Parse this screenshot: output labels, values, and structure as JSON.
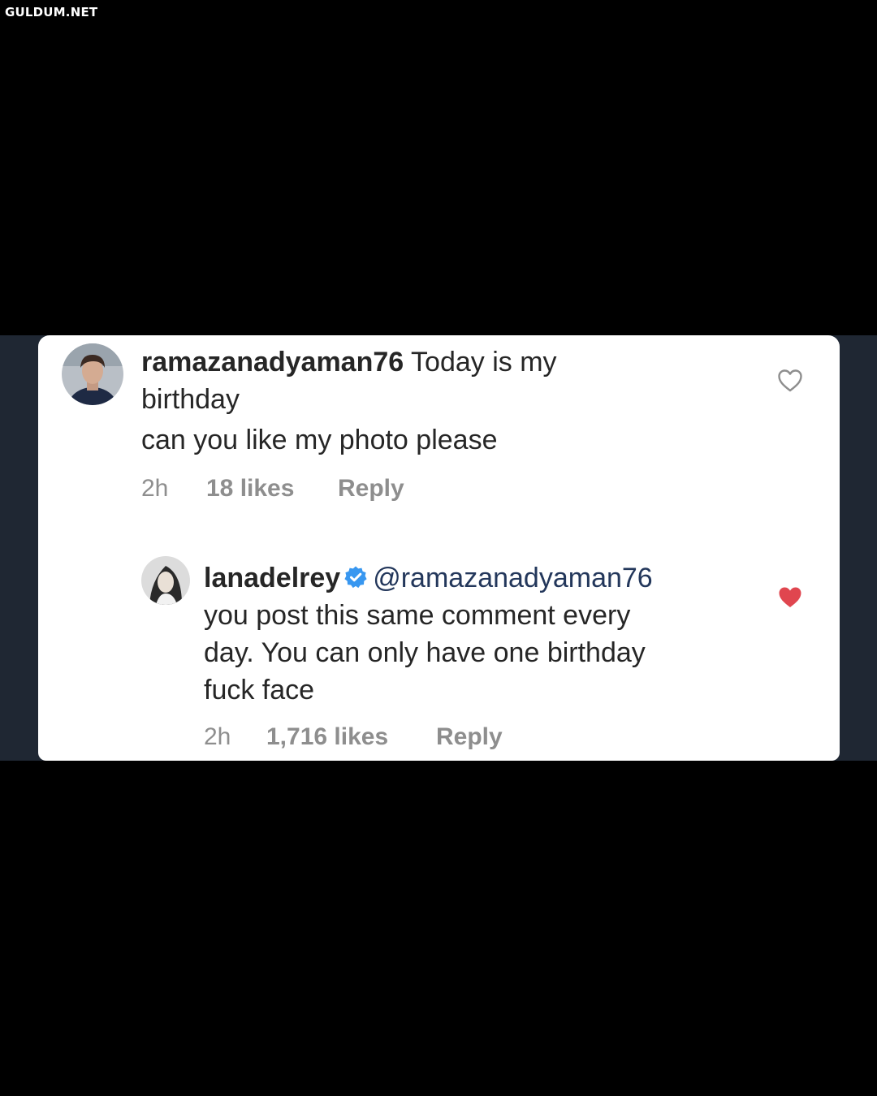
{
  "watermark": "GULDUM.NET",
  "colors": {
    "background": "#000000",
    "band": "#1f2733",
    "card": "#ffffff",
    "text": "#262626",
    "meta": "#8e8e8e",
    "mention": "#23375b",
    "verified": "#3897f0",
    "liked_heart": "#e0464f"
  },
  "comments": [
    {
      "username": "ramazanadyaman76",
      "text_lines": [
        "Today is my",
        "birthday",
        "can you like my photo please"
      ],
      "time": "2h",
      "likes": "18 likes",
      "reply": "Reply",
      "heart_icon": "heart-outline-icon"
    },
    {
      "username": "lanadelrey",
      "verified_icon": "verified-badge-icon",
      "mention": "@ramazanadyaman76",
      "text_lines": [
        "you post this same comment every",
        "day. You can only have one birthday",
        "fuck face"
      ],
      "time": "2h",
      "likes": "1,716 likes",
      "reply": "Reply",
      "heart_icon": "heart-filled-icon"
    }
  ]
}
